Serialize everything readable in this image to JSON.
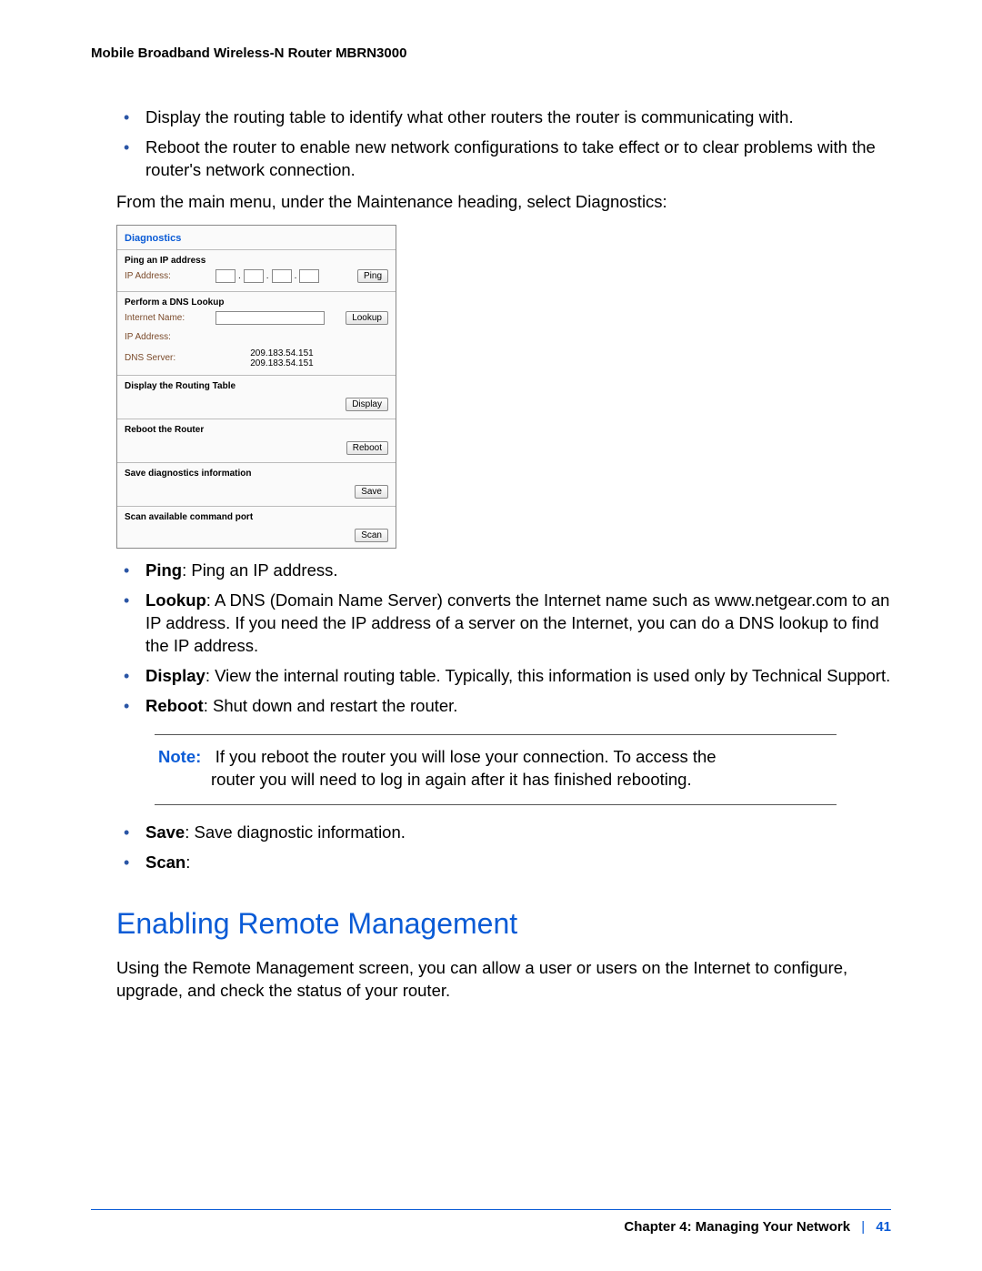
{
  "header": "Mobile Broadband Wireless-N Router MBRN3000",
  "top_bullets": [
    "Display the routing table to identify what other routers the router is communicating with.",
    "Reboot the router to enable new network configurations to take effect or to clear problems with the router's network connection."
  ],
  "intro_para": "From the main menu, under the Maintenance heading, select Diagnostics:",
  "panel": {
    "title": "Diagnostics",
    "ping": {
      "section": "Ping an IP address",
      "ip_label": "IP Address:",
      "btn": "Ping"
    },
    "dns": {
      "section": "Perform a DNS Lookup",
      "internet_label": "Internet Name:",
      "ip_label": "IP Address:",
      "dns_label": "DNS Server:",
      "dns1": "209.183.54.151",
      "dns2": "209.183.54.151",
      "btn": "Lookup"
    },
    "routing": {
      "section": "Display the Routing Table",
      "btn": "Display"
    },
    "reboot": {
      "section": "Reboot the Router",
      "btn": "Reboot"
    },
    "save": {
      "section": "Save diagnostics information",
      "btn": "Save"
    },
    "scan": {
      "section": "Scan available command port",
      "btn": "Scan"
    }
  },
  "def_bullets": {
    "ping": {
      "term": "Ping",
      "text": ": Ping an IP address."
    },
    "lookup": {
      "term": "Lookup",
      "text": ": A DNS (Domain Name Server) converts the Internet name such as www.netgear.com to an IP address. If you need the IP address of a server on the Internet, you can do a DNS lookup to find the IP address."
    },
    "display": {
      "term": "Display",
      "text": ": View the internal routing table. Typically, this information is used only by Technical Support."
    },
    "reboot": {
      "term": "Reboot",
      "text": ": Shut down and restart the router."
    },
    "save": {
      "term": "Save",
      "text": ": Save diagnostic information."
    },
    "scan": {
      "term": "Scan",
      "text": ":"
    }
  },
  "note": {
    "label": "Note:",
    "line1": "If you reboot the router you will lose your connection. To access the",
    "line2": "router you will need to log in again after it has finished rebooting."
  },
  "section_heading": "Enabling Remote Management",
  "section_para": "Using the Remote Management screen, you can allow a user or users on the Internet to configure, upgrade, and check the status of your router.",
  "footer": {
    "chapter": "Chapter 4:  Managing Your Network",
    "page": "41"
  }
}
